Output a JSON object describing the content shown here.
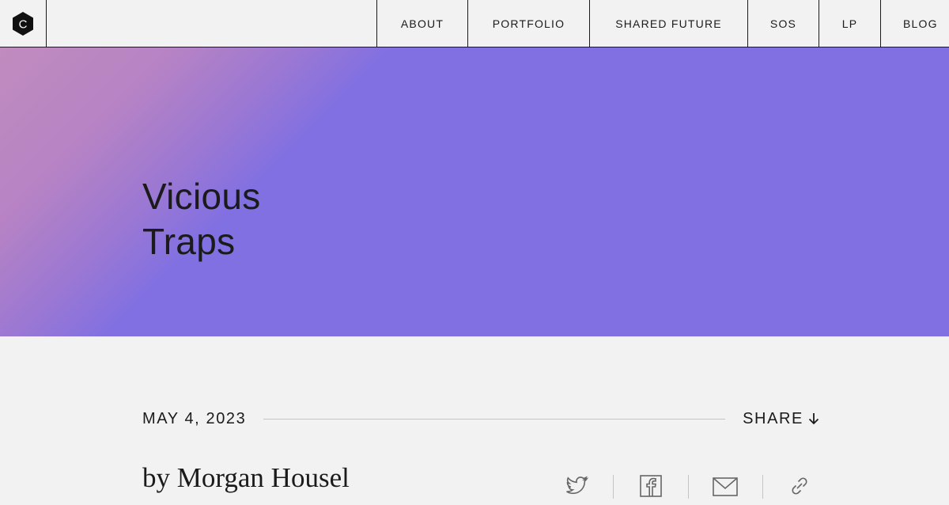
{
  "nav": {
    "logo_letter": "C",
    "links": [
      "About",
      "Portfolio",
      "Shared Future",
      "SOS",
      "LP",
      "Blog"
    ]
  },
  "hero": {
    "title_line1": "Vicious",
    "title_line2": "Traps"
  },
  "post": {
    "date": "May 4, 2023",
    "share_label": "Share",
    "author": "by Morgan Housel"
  },
  "share_icons": [
    "twitter-icon",
    "facebook-icon",
    "email-icon",
    "link-icon"
  ],
  "colors": {
    "hero_purple": "#8170e2",
    "hero_pink": "#c08cbe",
    "text": "#1b1b1b",
    "background": "#f2f2f2"
  }
}
